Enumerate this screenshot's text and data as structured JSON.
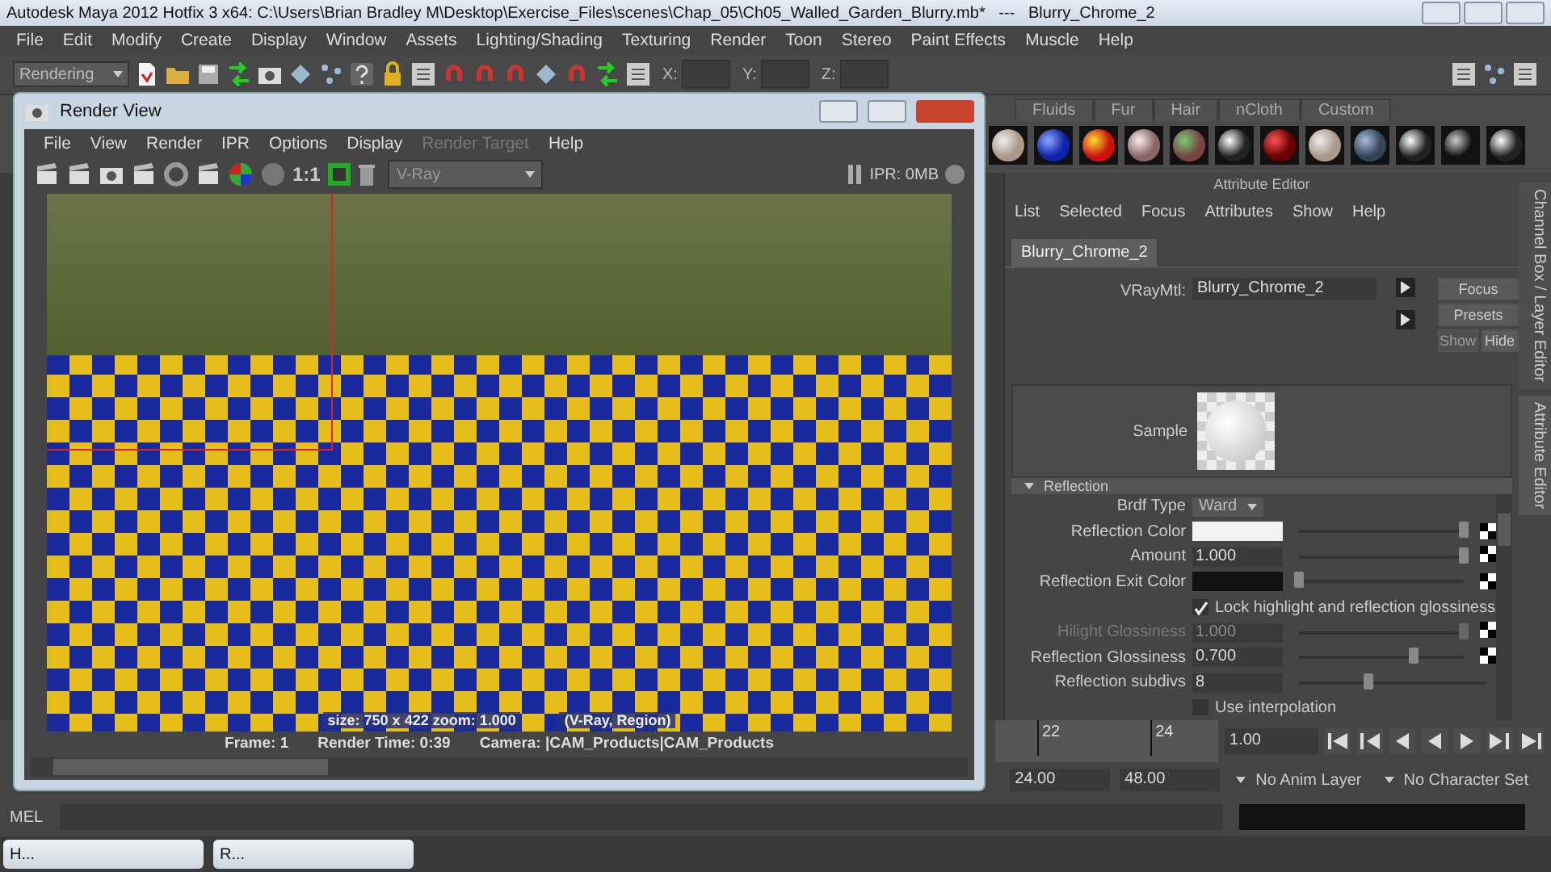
{
  "window": {
    "title": "Autodesk Maya 2012 Hotfix 3 x64: C:\\Users\\Brian Bradley M\\Desktop\\Exercise_Files\\scenes\\Chap_05\\Ch05_Walled_Garden_Blurry.mb*   ---   Blurry_Chrome_2"
  },
  "menu_bar": [
    "File",
    "Edit",
    "Modify",
    "Create",
    "Display",
    "Window",
    "Assets",
    "Lighting/Shading",
    "Texturing",
    "Render",
    "Toon",
    "Stereo",
    "Paint Effects",
    "Muscle",
    "Help"
  ],
  "toolbar": {
    "menu_set": "Rendering",
    "coordinates": [
      "X:",
      "Y:",
      "Z:"
    ]
  },
  "shelf": {
    "tabs": [
      "Fluids",
      "Fur",
      "Hair",
      "nCloth",
      "Custom"
    ]
  },
  "render_view": {
    "title": "Render View",
    "menus": [
      {
        "label": "File",
        "disabled": false
      },
      {
        "label": "View",
        "disabled": false
      },
      {
        "label": "Render",
        "disabled": false
      },
      {
        "label": "IPR",
        "disabled": false
      },
      {
        "label": "Options",
        "disabled": false
      },
      {
        "label": "Display",
        "disabled": false
      },
      {
        "label": "Render Target",
        "disabled": true
      },
      {
        "label": "Help",
        "disabled": false
      }
    ],
    "ratio": "1:1",
    "renderer": "V-Ray",
    "ipr": "IPR: 0MB",
    "overlay": [
      "size: 750 x 422 zoom: 1.000",
      "(V-Ray, Region)"
    ],
    "status": [
      "Frame: 1",
      "Render Time: 0:39",
      "Camera: |CAM_Products|CAM_Products"
    ]
  },
  "attribute_editor": {
    "title": "Attribute Editor",
    "menus": [
      "List",
      "Selected",
      "Focus",
      "Attributes",
      "Show",
      "Help"
    ],
    "tabs": [
      {
        "label": "Blurry_Chrome_2",
        "selected": true
      }
    ],
    "node_type": "VRayMtl:",
    "node_name": "Blurry_Chrome_2",
    "buttons": [
      {
        "label": "Focus",
        "disabled": false
      },
      {
        "label": "Presets",
        "disabled": false
      },
      {
        "label": "Show",
        "disabled": true
      },
      {
        "label": "Hide",
        "disabled": false
      }
    ],
    "sample_label": "Sample",
    "section": {
      "title": "Reflection",
      "expanded": true
    },
    "rows": [
      {
        "kind": "dropdown",
        "label": "Brdf Type",
        "value": "Ward"
      },
      {
        "kind": "color",
        "label": "Reflection Color",
        "color": "#f2f2f2",
        "level": 1.0
      },
      {
        "kind": "number",
        "label": "Amount",
        "value": "1.000",
        "level": 1.0,
        "disabled": false,
        "map_button": true
      },
      {
        "kind": "color",
        "label": "Reflection Exit Color",
        "color": "#111111",
        "level": 0.0
      },
      {
        "kind": "checkbox",
        "label": "Lock highlight and reflection glossiness",
        "checked": true
      },
      {
        "kind": "number",
        "label": "Hilight Glossiness",
        "value": "1.000",
        "level": 1.0,
        "disabled": true,
        "map_button": true
      },
      {
        "kind": "number",
        "label": "Reflection Glossiness",
        "value": "0.700",
        "level": 0.7,
        "disabled": false,
        "map_button": true
      },
      {
        "kind": "number",
        "label": "Reflection subdivs",
        "value": "8",
        "level": 0.37,
        "disabled": false,
        "map_button": false
      },
      {
        "kind": "checkbox",
        "label": "Use interpolation",
        "checked": false
      }
    ]
  },
  "side_tabs": [
    "Channel Box / Layer Editor",
    "Attribute Editor"
  ],
  "timeline": {
    "ticks": [
      "22",
      "24"
    ],
    "current_frame": "1.00"
  },
  "range": {
    "start": "24.00",
    "end": "48.00",
    "anim_layer": "No Anim Layer",
    "character_set": "No Character Set"
  },
  "command_line": {
    "label": "MEL"
  },
  "taskbar": [
    "H...",
    "R..."
  ]
}
